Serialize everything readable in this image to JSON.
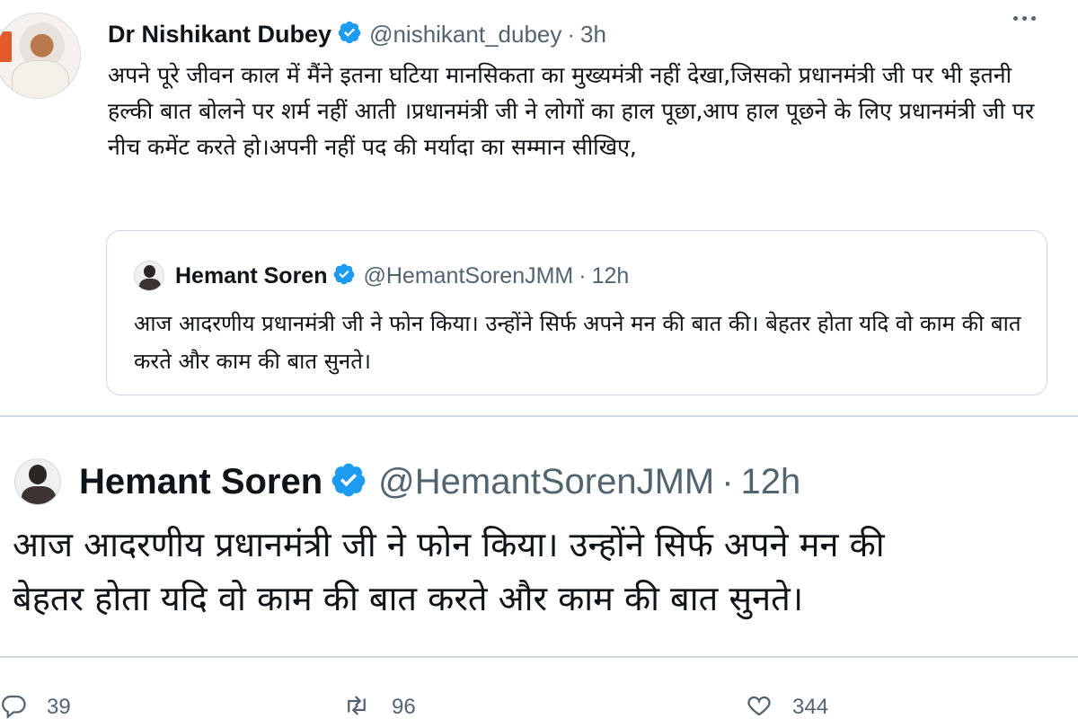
{
  "main_tweet": {
    "author_name": "Dr Nishikant Dubey",
    "handle": "@nishikant_dubey",
    "separator": "·",
    "time": "3h",
    "text": "अपने पूरे जीवन काल में मैंने इतना घटिया मानसिकता का मुख्यमंत्री  नहीं देखा,जिसको प्रधानमंत्री जी पर भी इतनी हल्की बात बोलने पर शर्म नहीं आती ।प्रधानमंत्री जी ने लोगों का हाल पूछा,आप हाल पूछने के लिए प्रधानमंत्री जी पर नीच कमेंट करते हो।अपनी नहीं पद की मर्यादा का सम्मान सीखिए,"
  },
  "quoted_tweet": {
    "author_name": "Hemant Soren",
    "handle": "@HemantSorenJMM",
    "separator": "·",
    "time": "12h",
    "text": "आज आदरणीय प्रधानमंत्री जी ने फोन किया। उन्होंने सिर्फ अपने मन की बात की। बेहतर होता यदि वो काम की बात करते और काम की बात सुनते।"
  },
  "zoomed_tweet": {
    "author_name": "Hemant Soren",
    "handle": "@HemantSorenJMM",
    "separator": "·",
    "time": "12h",
    "line1": "आज आदरणीय प्रधानमंत्री जी ने फोन किया। उन्होंने सिर्फ अपने मन की",
    "line2": "बेहतर होता यदि वो काम की बात करते और काम की बात सुनते।"
  },
  "actions": {
    "reply_count": "39",
    "retweet_count": "96",
    "like_count": "344"
  },
  "icons": {
    "verified": "verified-badge-icon",
    "more": "more-icon",
    "reply": "reply-icon",
    "retweet": "retweet-icon",
    "like": "heart-icon"
  },
  "colors": {
    "verified_blue": "#1d9bf0",
    "secondary_text": "#536471",
    "border": "#cfd9de"
  }
}
